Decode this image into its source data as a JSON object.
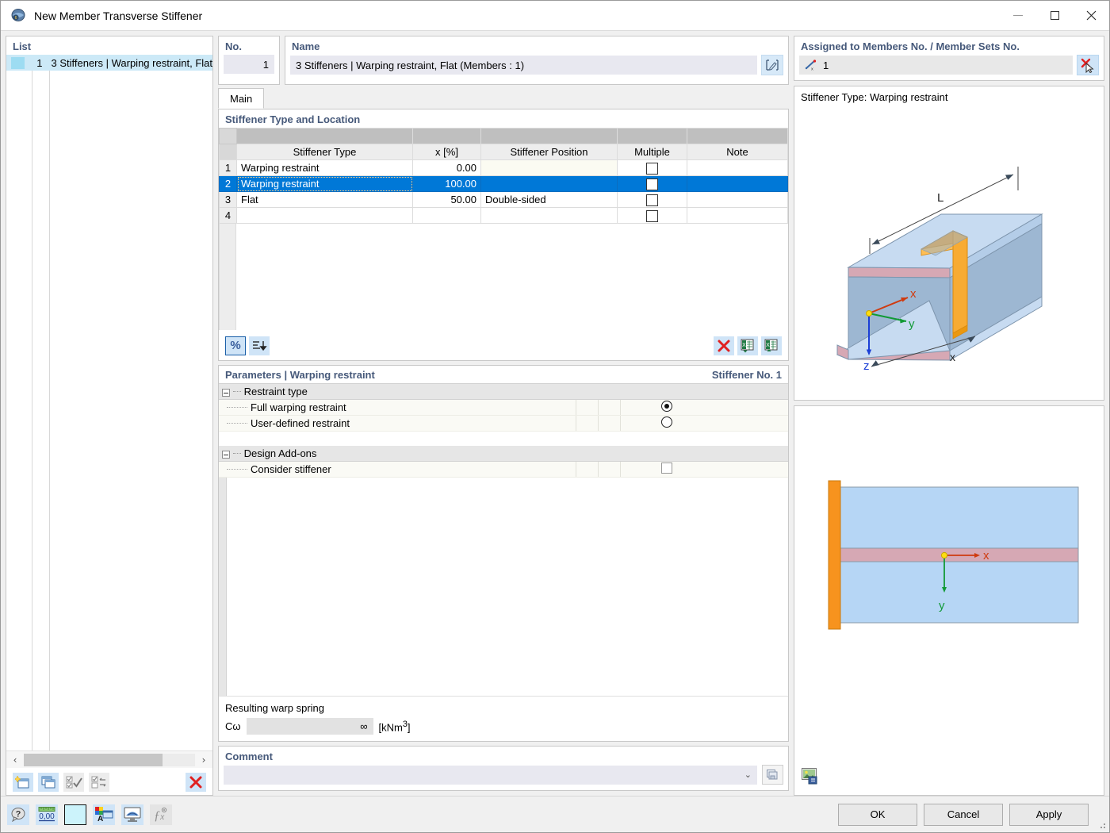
{
  "window": {
    "title": "New Member Transverse Stiffener",
    "app_icon": "dialog-icon",
    "minimize": "–",
    "maximize": "□",
    "close": "✕"
  },
  "list_panel": {
    "header": "List",
    "rows": [
      {
        "swatch": "color-swatch",
        "no": "1",
        "label": "3 Stiffeners | Warping restraint, Flat"
      }
    ],
    "scroll_left": "‹",
    "scroll_right": "›",
    "toolbar": [
      {
        "name": "new-item-button",
        "icon": "new-window-icon",
        "enabled": true
      },
      {
        "name": "copy-item-button",
        "icon": "copy-window-icon",
        "enabled": true
      },
      {
        "name": "select-all-button",
        "icon": "check-all-icon",
        "enabled": false
      },
      {
        "name": "invert-selection-button",
        "icon": "invert-check-icon",
        "enabled": false
      },
      {
        "name": "delete-item-button",
        "icon": "red-x-icon",
        "enabled": true
      }
    ]
  },
  "no_box": {
    "header": "No.",
    "value": "1"
  },
  "name_box": {
    "header": "Name",
    "value": "3 Stiffeners | Warping restraint, Flat (Members : 1)",
    "edit_button": "edit-name-icon"
  },
  "assigned_box": {
    "header": "Assigned to Members No. / Member Sets No.",
    "icon": "member-line-icon",
    "value": "1",
    "pick_button": "pick-members-icon"
  },
  "tabs": [
    {
      "label": "Main",
      "active": true
    }
  ],
  "stiffener_table": {
    "header": "Stiffener Type and Location",
    "columns": [
      "",
      "Stiffener Type",
      "x [%]",
      "Stiffener Position",
      "Multiple",
      "Note"
    ],
    "rows": [
      {
        "no": "1",
        "type": "Warping restraint",
        "x": "0.00",
        "position": "",
        "multiple": false,
        "note": "",
        "selected": false
      },
      {
        "no": "2",
        "type": "Warping restraint",
        "x": "100.00",
        "position": "",
        "multiple": false,
        "note": "",
        "selected": true
      },
      {
        "no": "3",
        "type": "Flat",
        "x": "50.00",
        "position": "Double-sided",
        "multiple": false,
        "note": "",
        "selected": false
      },
      {
        "no": "4",
        "type": "",
        "x": "",
        "position": "",
        "multiple": false,
        "note": "",
        "selected": false
      }
    ],
    "toolbar_left": [
      {
        "name": "percent-toggle-button",
        "icon": "percent-icon",
        "label": "%",
        "active": true
      },
      {
        "name": "sort-button",
        "icon": "sort-descending-icon",
        "active": false
      }
    ],
    "toolbar_right": [
      {
        "name": "delete-row-button",
        "icon": "red-x-icon"
      },
      {
        "name": "import-excel-button",
        "icon": "excel-import-icon"
      },
      {
        "name": "export-excel-button",
        "icon": "excel-export-icon"
      }
    ]
  },
  "parameters": {
    "title": "Parameters | Warping restraint",
    "stiffener_no": "Stiffener No. 1",
    "groups": [
      {
        "name": "Restraint type",
        "expanded": true,
        "items": [
          {
            "label": "Full warping restraint",
            "control": "radio",
            "checked": true
          },
          {
            "label": "User-defined restraint",
            "control": "radio",
            "checked": false
          }
        ]
      },
      {
        "name": "Design Add-ons",
        "expanded": true,
        "items": [
          {
            "label": "Consider stiffener",
            "control": "checkbox",
            "checked": false
          }
        ]
      }
    ],
    "warp_spring": {
      "label": "Resulting warp spring",
      "symbol": "Cω",
      "value": "∞",
      "unit_prefix": "[kNm",
      "unit_sup": "3",
      "unit_suffix": "]"
    }
  },
  "comment": {
    "header": "Comment",
    "value": "",
    "placeholder": "",
    "dropdown_icon": "chevron-down-icon",
    "button_icon": "comment-library-icon"
  },
  "graphic_top": {
    "label": "Stiffener Type: Warping restraint",
    "annotations": {
      "length": "L",
      "position": "x",
      "axis_x": "x",
      "axis_y": "y",
      "axis_z": "z"
    }
  },
  "graphic_bottom": {
    "annotations": {
      "axis_x": "x",
      "axis_y": "y"
    },
    "snapshot_button": "save-image-icon"
  },
  "status_bar": {
    "buttons": [
      {
        "name": "help-button",
        "icon": "help-icon"
      },
      {
        "name": "units-button",
        "icon": "units-icon",
        "label": "0,00"
      },
      {
        "name": "color-button",
        "icon": "color-swatch-icon"
      },
      {
        "name": "display-properties-button",
        "icon": "display-properties-icon"
      },
      {
        "name": "view-settings-button",
        "icon": "view-settings-icon"
      },
      {
        "name": "formula-button",
        "icon": "function-icon",
        "label": "ƒx",
        "enabled": false
      }
    ]
  },
  "dialog_buttons": [
    {
      "name": "ok-button",
      "label": "OK"
    },
    {
      "name": "cancel-button",
      "label": "Cancel"
    },
    {
      "name": "apply-button",
      "label": "Apply"
    }
  ],
  "colors": {
    "accent_blue": "#0078d7",
    "header_text": "#46597a",
    "icon_blue_bg": "#cfe4f7",
    "red": "#e02020",
    "stiffener_orange": "#f5a020",
    "beam_blue": "#b8d4f0"
  }
}
